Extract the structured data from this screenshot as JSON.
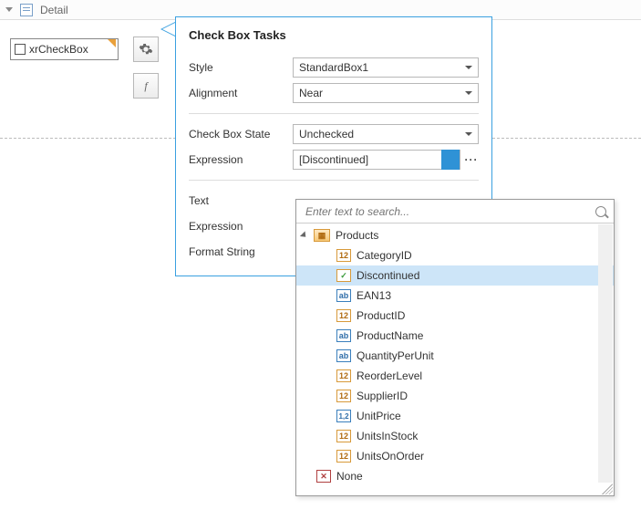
{
  "header": {
    "label": "Detail"
  },
  "control": {
    "label": "xrCheckBox"
  },
  "toolButtons": {
    "fx_label": "f"
  },
  "popup": {
    "title": "Check Box Tasks",
    "rows": {
      "style": {
        "label": "Style",
        "value": "StandardBox1"
      },
      "alignment": {
        "label": "Alignment",
        "value": "Near"
      },
      "checkState": {
        "label": "Check Box State",
        "value": "Unchecked"
      },
      "expression": {
        "label": "Expression",
        "value": "[Discontinued]"
      },
      "text": {
        "label": "Text"
      },
      "expression2": {
        "label": "Expression"
      },
      "formatString": {
        "label": "Format String"
      }
    }
  },
  "dropdown": {
    "searchPlaceholder": "Enter text to search...",
    "root": {
      "label": "Products"
    },
    "fields": [
      {
        "icon": "12",
        "label": "CategoryID"
      },
      {
        "icon": "chk",
        "label": "Discontinued",
        "selected": true
      },
      {
        "icon": "ab",
        "label": "EAN13"
      },
      {
        "icon": "12",
        "label": "ProductID"
      },
      {
        "icon": "ab",
        "label": "ProductName"
      },
      {
        "icon": "ab",
        "label": "QuantityPerUnit"
      },
      {
        "icon": "12",
        "label": "ReorderLevel"
      },
      {
        "icon": "12",
        "label": "SupplierID"
      },
      {
        "icon": "dec",
        "label": "UnitPrice"
      },
      {
        "icon": "12",
        "label": "UnitsInStock"
      },
      {
        "icon": "12",
        "label": "UnitsOnOrder"
      }
    ],
    "none": {
      "label": "None"
    }
  }
}
